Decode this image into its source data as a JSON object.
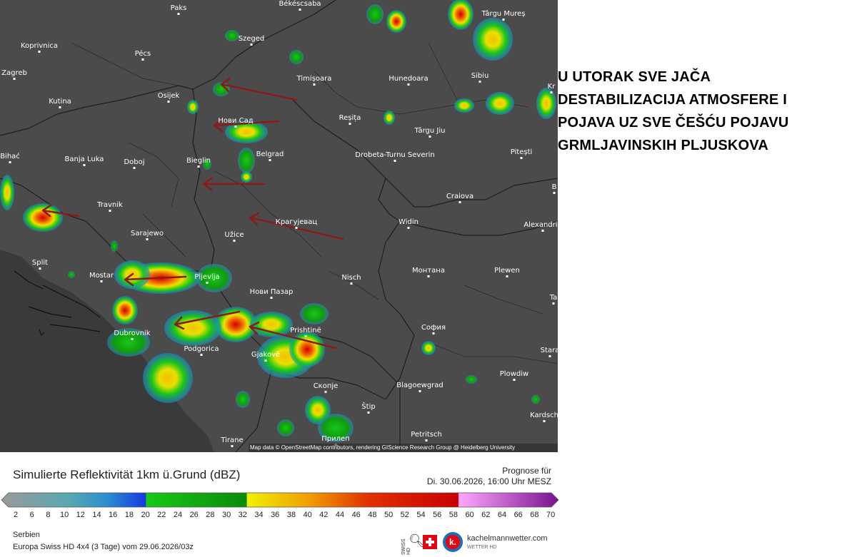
{
  "headline": [
    "U UTORAK SVE JAČA",
    "DESTABILIZACIJA ATMOSFERE I",
    "POJAVA UZ SVE ČEŠĆU POJAVU",
    "GRMLJAVINSKIH PLJUSKOVA"
  ],
  "map": {
    "cities": [
      "Paks",
      "Békéscsaba",
      "Târgu Mureș",
      "Koprivnica",
      "Pécs",
      "Szeged",
      "Zagreb",
      "Osijek",
      "Timișoara",
      "Hunedoara",
      "Sibiu",
      "Kutina",
      "Нови Сад",
      "Reșița",
      "Târgu Jiu",
      "Pitești",
      "Banja Luka",
      "Doboj",
      "Bieglin",
      "Belgrad",
      "Drobeta-Turnu Severin",
      "Bihać",
      "Travnik",
      "Craiova",
      "Sarajewo",
      "Užice",
      "Крагујевац",
      "Widin",
      "Alexandria",
      "Split",
      "Mostar",
      "Pljevlja",
      "Монтана",
      "Plewen",
      "Nisch",
      "Нови Пазар",
      "Dubrovnik",
      "Prishtinë",
      "София",
      "Podgorica",
      "Gjakovë",
      "Plowdiw",
      "Скопје",
      "Blagoewgrad",
      "Štip",
      "Kardsch",
      "Stara",
      "Tirane",
      "Petritsch",
      "Прилеп",
      "Kr",
      "B",
      "Ta"
    ],
    "attribution": "Map data © OpenStreetMap contributors, rendering GIScience Research Group @ Heidelberg University"
  },
  "legend": {
    "title": "Simulierte Reflektivität 1km ü.Grund (dBZ)",
    "forecast_label": "Prognose für",
    "forecast_time": "Di. 30.06.2026, 16:00 Uhr MESZ",
    "ticks": [
      "2",
      "6",
      "8",
      "10",
      "12",
      "14",
      "16",
      "18",
      "20",
      "22",
      "24",
      "26",
      "28",
      "30",
      "32",
      "34",
      "36",
      "38",
      "40",
      "42",
      "44",
      "46",
      "48",
      "50",
      "52",
      "54",
      "56",
      "58",
      "60",
      "62",
      "64",
      "66",
      "68",
      "70"
    ],
    "colors": [
      "#9a9a9a",
      "#6aa6b4",
      "#3c8ec0",
      "#1e50dc",
      "#0a1ea0",
      "#18c818",
      "#0a8a0a",
      "#f0f000",
      "#f0a000",
      "#e04000",
      "#c80000",
      "#ff90ff",
      "#c850d0",
      "#7a1090"
    ],
    "region": "Serbien",
    "model": "Europa Swiss HD 4x4 (3 Tage) vom 29.06.2026/03z"
  },
  "logos": {
    "swiss_small": "SWISS HD",
    "brand": "kachelmannwetter.com",
    "brand_sub": "WETTER HD",
    "k_letter": "k."
  }
}
